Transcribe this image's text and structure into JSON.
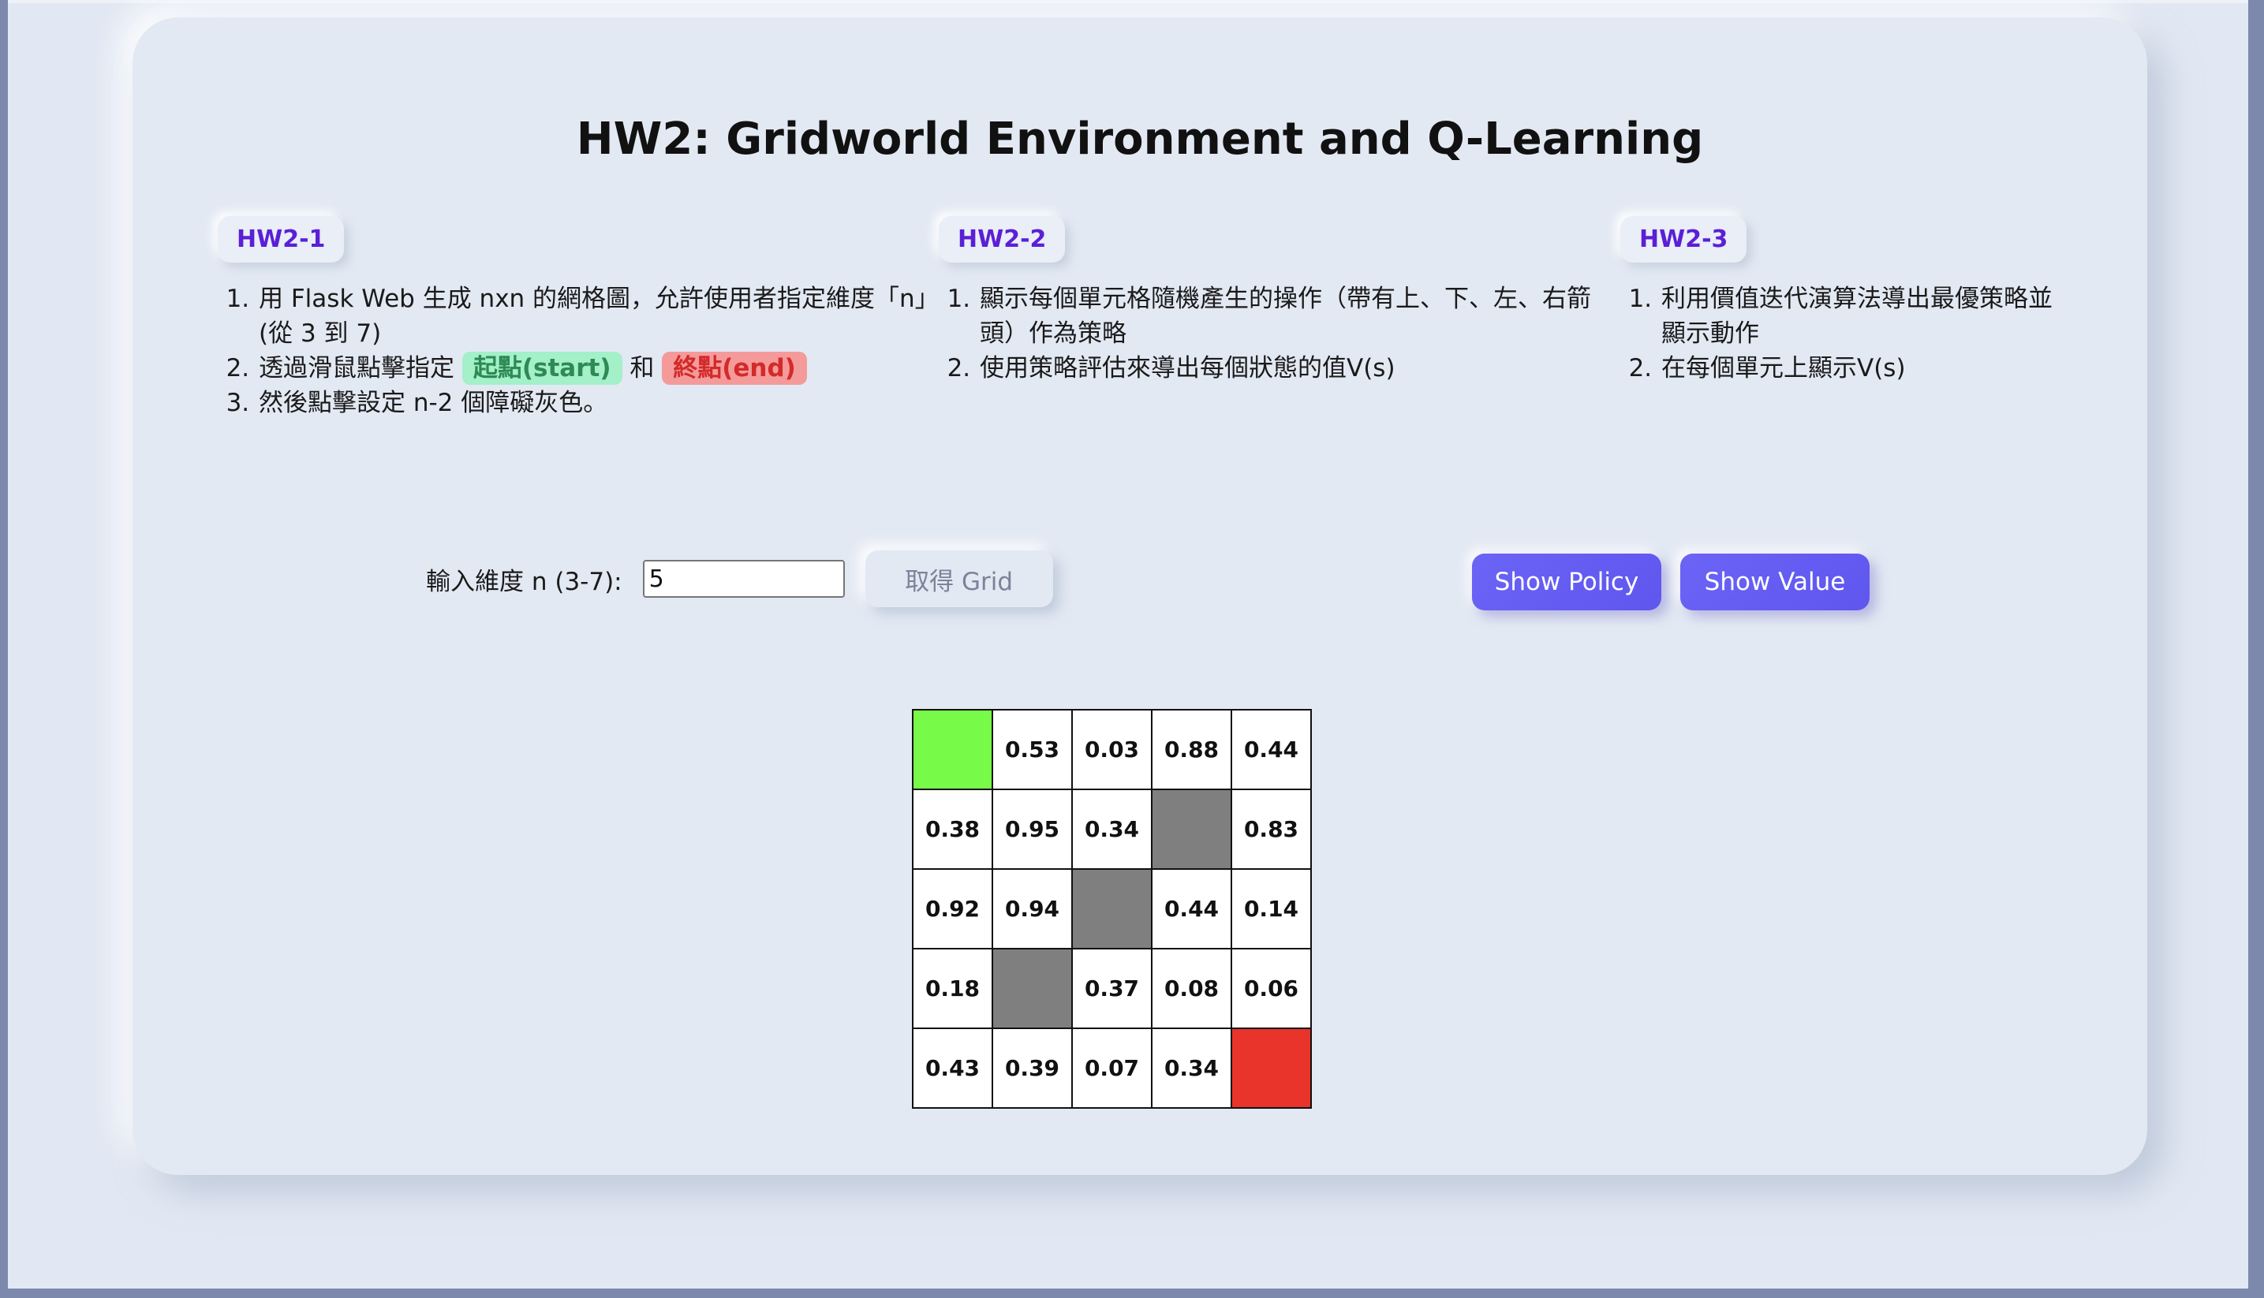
{
  "page": {
    "title": "HW2: Gridworld Environment and Q-Learning"
  },
  "sections": [
    {
      "tag": "HW2-1",
      "items": [
        "用 Flask Web 生成 nxn 的網格圖，允許使用者指定維度「n」(從 3 到 7)",
        "透過滑鼠點擊指定",
        "然後點擊設定 n-2 個障礙灰色。"
      ],
      "start_label": "起點(start)",
      "and_text": "和",
      "end_label": "終點(end)"
    },
    {
      "tag": "HW2-2",
      "items": [
        "顯示每個單元格隨機產生的操作（帶有上、下、左、右箭頭）作為策略",
        "使用策略評估來導出每個狀態的值V(s)"
      ]
    },
    {
      "tag": "HW2-3",
      "items": [
        "利用價值迭代演算法導出最優策略並顯示動作",
        "在每個單元上顯示V(s)"
      ]
    }
  ],
  "controls": {
    "dimension_label": "輸入維度 n (3-7):",
    "dimension_value": "5",
    "get_grid_label": "取得 Grid",
    "show_policy_label": "Show Policy",
    "show_value_label": "Show Value"
  },
  "colors": {
    "start": "#77fb48",
    "end": "#e8342a",
    "obstacle": "#7f7f7f",
    "accent": "#6b64f5",
    "tag_text": "#5b1fd6"
  },
  "grid": {
    "n": 5,
    "rows": [
      [
        {
          "type": "start",
          "value": ""
        },
        {
          "type": "empty",
          "value": "0.53"
        },
        {
          "type": "empty",
          "value": "0.03"
        },
        {
          "type": "empty",
          "value": "0.88"
        },
        {
          "type": "empty",
          "value": "0.44"
        }
      ],
      [
        {
          "type": "empty",
          "value": "0.38"
        },
        {
          "type": "empty",
          "value": "0.95"
        },
        {
          "type": "empty",
          "value": "0.34"
        },
        {
          "type": "obstacle",
          "value": ""
        },
        {
          "type": "empty",
          "value": "0.83"
        }
      ],
      [
        {
          "type": "empty",
          "value": "0.92"
        },
        {
          "type": "empty",
          "value": "0.94"
        },
        {
          "type": "obstacle",
          "value": ""
        },
        {
          "type": "empty",
          "value": "0.44"
        },
        {
          "type": "empty",
          "value": "0.14"
        }
      ],
      [
        {
          "type": "empty",
          "value": "0.18"
        },
        {
          "type": "obstacle",
          "value": ""
        },
        {
          "type": "empty",
          "value": "0.37"
        },
        {
          "type": "empty",
          "value": "0.08"
        },
        {
          "type": "empty",
          "value": "0.06"
        }
      ],
      [
        {
          "type": "empty",
          "value": "0.43"
        },
        {
          "type": "empty",
          "value": "0.39"
        },
        {
          "type": "empty",
          "value": "0.07"
        },
        {
          "type": "empty",
          "value": "0.34"
        },
        {
          "type": "end",
          "value": ""
        }
      ]
    ]
  }
}
